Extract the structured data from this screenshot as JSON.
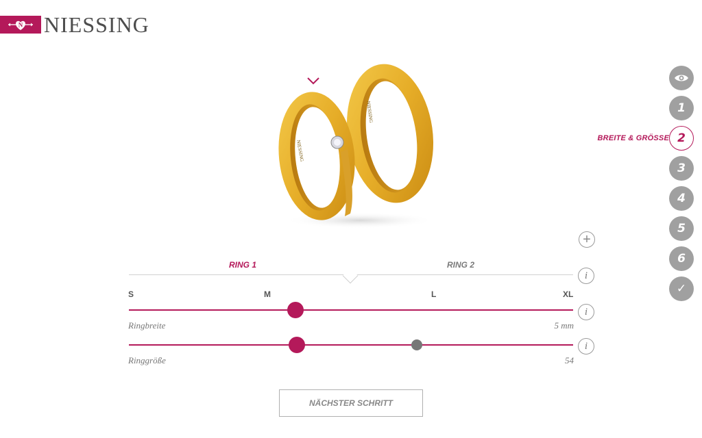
{
  "brand": {
    "name": "NIESSING",
    "color": "#b4195a"
  },
  "steps": {
    "active_label": "BREITE & GRÖSSE",
    "items": [
      {
        "label": "",
        "icon": "eye-icon"
      },
      {
        "label": "1"
      },
      {
        "label": "2"
      },
      {
        "label": "3"
      },
      {
        "label": "4"
      },
      {
        "label": "5"
      },
      {
        "label": "6"
      },
      {
        "label": "✓",
        "icon": "check-icon"
      }
    ]
  },
  "tabs": {
    "ring1": "RING 1",
    "ring2": "RING 2"
  },
  "sizes": {
    "s": "S",
    "m": "M",
    "l": "L",
    "xl": "XL"
  },
  "sliders": {
    "width": {
      "caption": "Ringbreite",
      "value": "5 mm"
    },
    "size": {
      "caption": "Ringgröße",
      "value": "54"
    }
  },
  "next_button": "NÄCHSTER SCHRITT",
  "plus": "+",
  "info": "i"
}
